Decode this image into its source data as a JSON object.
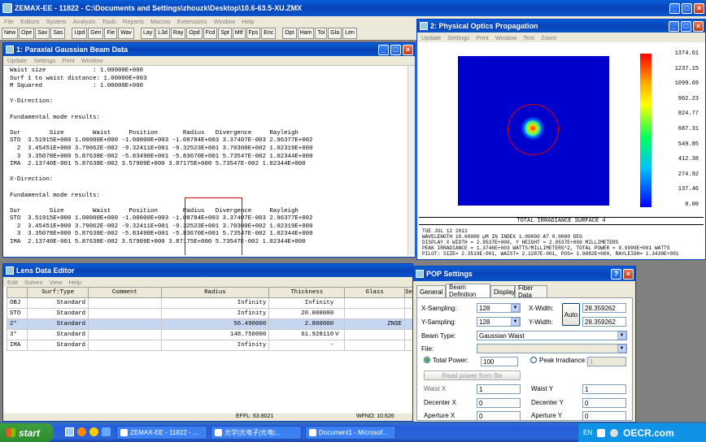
{
  "main": {
    "title": "ZEMAX-EE - 11822 - C:\\Documents and Settings\\zhouzk\\Desktop\\10.6-63.5-XU.ZMX",
    "menu": [
      "File",
      "Editors",
      "System",
      "Analysis",
      "Tools",
      "Reports",
      "Macros",
      "Extensions",
      "Window",
      "Help"
    ],
    "toolbar": [
      {
        "label": "New",
        "gap": false
      },
      {
        "label": "Ope",
        "gap": false
      },
      {
        "label": "Sav",
        "gap": false
      },
      {
        "label": "Sas",
        "gap": false
      },
      {
        "label": "Upd",
        "gap": true
      },
      {
        "label": "Gen",
        "gap": false
      },
      {
        "label": "Fie",
        "gap": false
      },
      {
        "label": "Wav",
        "gap": false
      },
      {
        "label": "Lay",
        "gap": true
      },
      {
        "label": "L3d",
        "gap": false
      },
      {
        "label": "Ray",
        "gap": false
      },
      {
        "label": "Opd",
        "gap": false
      },
      {
        "label": "Fcd",
        "gap": false
      },
      {
        "label": "Spt",
        "gap": false
      },
      {
        "label": "Mtf",
        "gap": false
      },
      {
        "label": "Fps",
        "gap": false
      },
      {
        "label": "Enc",
        "gap": false
      },
      {
        "label": "Opt",
        "gap": true
      },
      {
        "label": "Ham",
        "gap": false
      },
      {
        "label": "Tol",
        "gap": false
      },
      {
        "label": "Gla",
        "gap": false
      },
      {
        "label": "Len",
        "gap": false
      }
    ]
  },
  "pgb": {
    "title": "1: Paraxial Gaussian Beam Data",
    "menu": [
      "Update",
      "Settings",
      "Print",
      "Window"
    ],
    "text": "Waist size             : 1.00000E+000\nSurf 1 to waist distance: 1.00000E+003\nM Squared              : 1.00000E+000\n\nY-Direction:\n\nFundamental mode results:\n\nSur        Size        Waist     Position       Radius   Divergence     Rayleigh\nSTO  3.51915E+000 1.00000E+000 -1.00000E+003 -1.08784E+003 3.37407E-003 2.96377E+002\n  2  3.45451E+000 3.79062E-002 -9.32411E+001 -9.32523E+001 3.70300E+002 1.02319E+000\n  3  3.35078E+000 5.87638E-002 -5.83490E+001 -5.83670E+001 5.73547E-002 1.02344E+000\nIMA  2.13740E-001 5.87638E-002 3.57909E+000 3.87175E+000 5.73547E-002 1.02344E+000\n\nX-Direction:\n\nFundamental mode results:\n\nSur        Size        Waist     Position       Radius   Divergence     Rayleigh\nSTO  3.51915E+000 1.00000E+000 -1.00000E+003 -1.08784E+003 3.37407E-003 2.96377E+002\n  2  3.45451E+000 3.79062E-002 -9.32411E+001 -9.32523E+001 3.70300E+002 1.02319E+000\n  3  3.35078E+000 5.87638E-002 -5.83490E+001 -5.83670E+001 5.73547E-002 1.02344E+000\nIMA  2.13740E-001 5.87638E-002 3.57909E+000 3.87175E+000 5.73547E-002 1.02344E+000"
  },
  "pop": {
    "title": "2: Physical Optics Propagation",
    "menu": [
      "Update",
      "Settings",
      "Print",
      "Window",
      "Text",
      "Zoom"
    ],
    "colorbar_ticks": [
      "1374.61",
      "1237.15",
      "1099.69",
      "962.23",
      "824.77",
      "687.31",
      "549.85",
      "412.38",
      "274.92",
      "137.46",
      "0.00"
    ],
    "caption": "TOTAL IRRADIANCE SURFACE 4",
    "info": [
      "TUE JUL 12 2011",
      "WAVELENGTH 10.60000 µM IN INDEX 1.00000 AT 0.0000 DEG",
      "DISPLAY X WIDTH = 2.9537E+000, Y HEIGHT = 2.9537E+000 MILLIMETERS",
      "PEAK IRRADIANCE = 1.3746E+003 WATTS/MILLIMETERS^2, TOTAL POWER = 9.9999E+001 WATTS",
      "PILOT: SIZE= 2.3519E-001, WAIST= 2.1287E-001, POS= 1.9882E+000, RAYLEIGH= 1.3430E+001"
    ]
  },
  "lde": {
    "title": "Lens Data Editor",
    "menu": [
      "Edit",
      "Solves",
      "View",
      "Help"
    ],
    "headers": [
      "Surf:Type",
      "Comment",
      "Radius",
      "Thickness",
      "Glass",
      "Se"
    ],
    "rows": [
      {
        "surf": "OBJ",
        "type": "Standard",
        "comment": "",
        "radius": "Infinity",
        "thickness": "Infinity",
        "tflag": "",
        "glass": "",
        "sel": false
      },
      {
        "surf": "STO",
        "type": "Standard",
        "comment": "",
        "radius": "Infinity",
        "thickness": "20.000000",
        "tflag": "",
        "glass": "",
        "sel": false
      },
      {
        "surf": "2*",
        "type": "Standard",
        "comment": "",
        "radius": "56.490000",
        "thickness": "2.800000",
        "tflag": "",
        "glass": "ZNSE",
        "sel": true
      },
      {
        "surf": "3*",
        "type": "Standard",
        "comment": "",
        "radius": "148.750000",
        "thickness": "61.928110",
        "tflag": "V",
        "glass": "",
        "sel": false
      },
      {
        "surf": "IMA",
        "type": "Standard",
        "comment": "",
        "radius": "Infinity",
        "thickness": "-",
        "tflag": "",
        "glass": "",
        "sel": false
      }
    ],
    "status1": "EFFL: 63.8021",
    "status2": "WFNO: 10.626"
  },
  "dialog": {
    "title": "POP Settings",
    "tabs": [
      "General",
      "Beam Definition",
      "Display",
      "Fiber Data"
    ],
    "active_tab": "Beam Definition",
    "x_sampling_label": "X-Sampling:",
    "x_sampling": "128",
    "y_sampling_label": "Y-Sampling:",
    "y_sampling": "128",
    "x_width_label": "X-Width:",
    "x_width": "28.359262",
    "y_width_label": "Y-Width:",
    "y_width": "28.359262",
    "auto_label": "Auto",
    "beam_type_label": "Beam Type:",
    "beam_type": "Gaussian Waist",
    "file_label": "File:",
    "total_power_label": "Total Power:",
    "total_power": "100",
    "peak_label": "Peak Irradiance:",
    "peak": "1",
    "read_label": "Read power from file",
    "waist_x_label": "Waist X",
    "waist_x": "1",
    "waist_y_label": "Waist Y",
    "waist_y": "1",
    "decenter_x_label": "Decenter X",
    "decenter_x": "0",
    "decenter_y_label": "Decenter Y",
    "decenter_y": "0",
    "aperture_x_label": "Aperture X",
    "aperture_x": "0",
    "aperture_y_label": "Aperture Y",
    "aperture_y": "0"
  },
  "taskbar": {
    "start": "start",
    "tasks": [
      "ZEMAX-EE - 11822 - ...",
      "光学|光电子|光电|...",
      "Document1 - Microsof..."
    ],
    "lang": "EN",
    "watermark": "OECR.com"
  }
}
